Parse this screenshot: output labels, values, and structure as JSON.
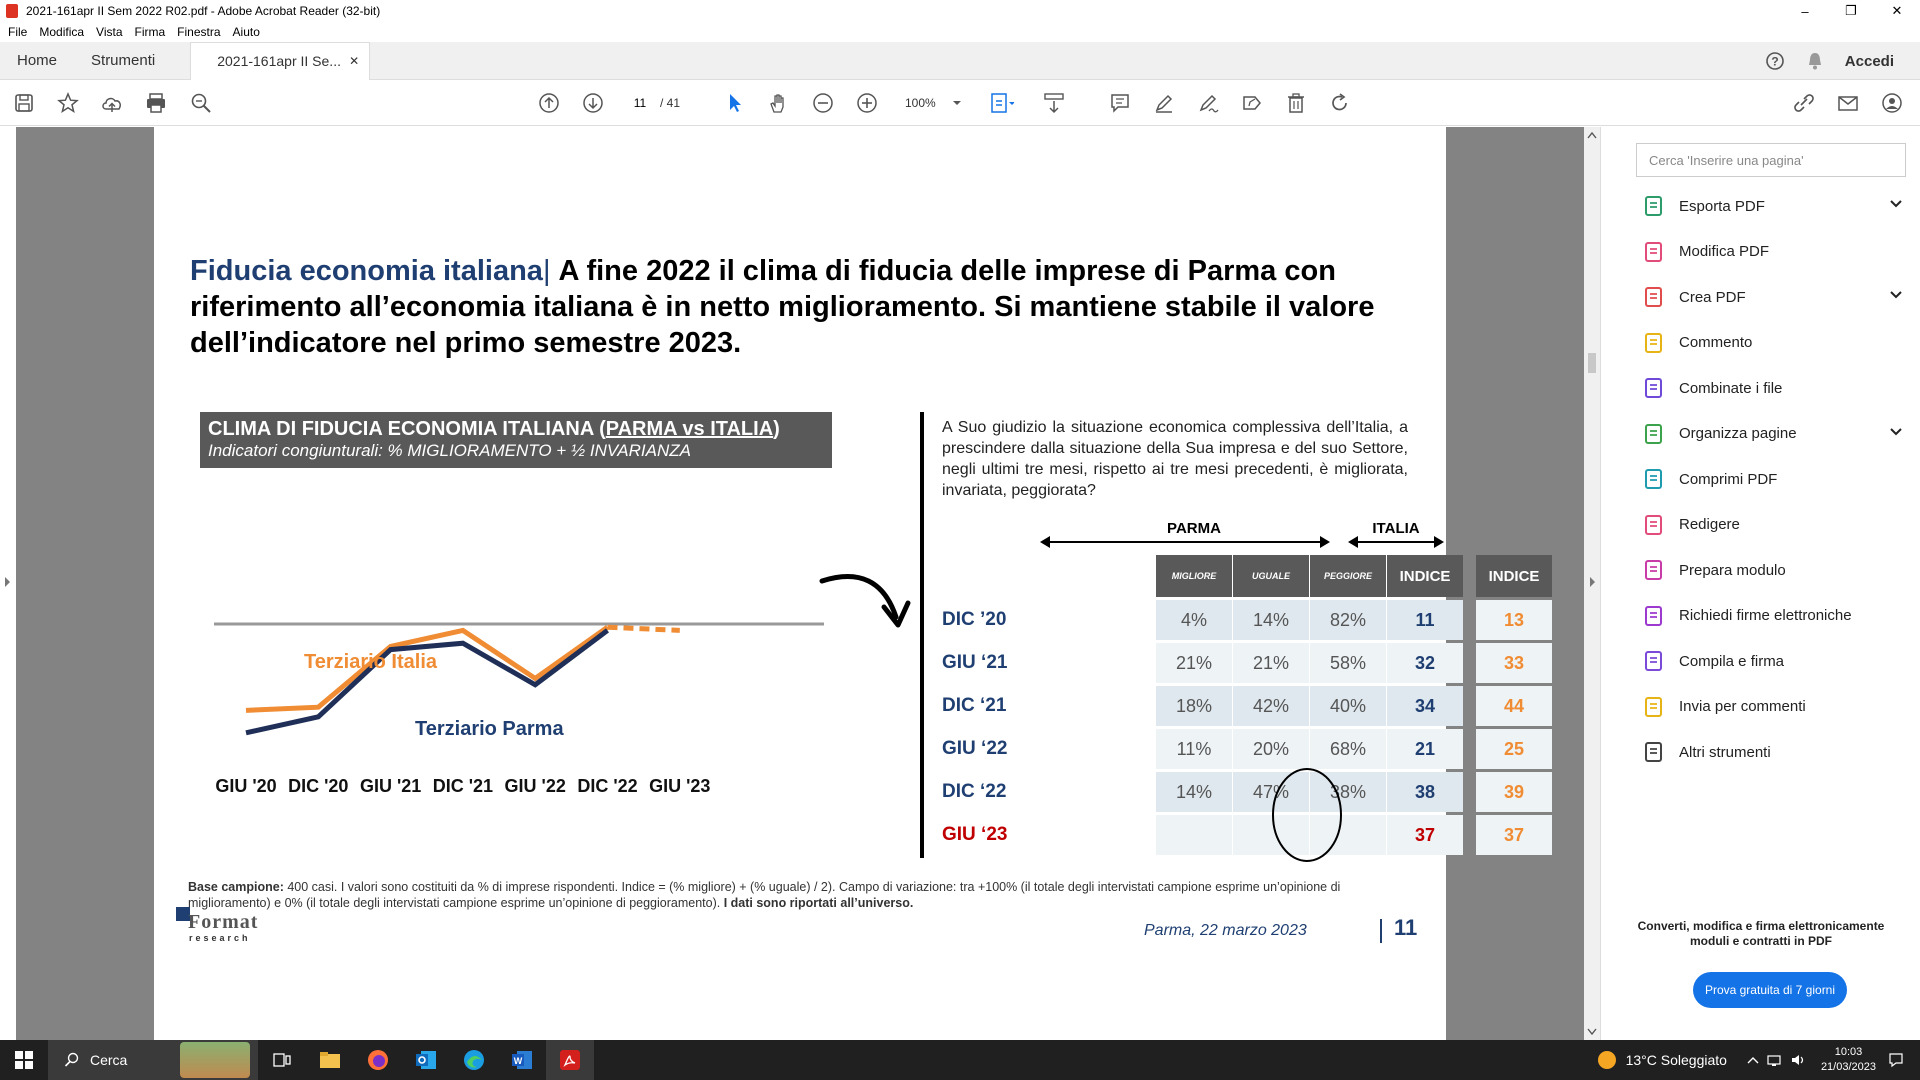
{
  "window": {
    "title": "2021-161apr II Sem 2022 R02.pdf - Adobe Acrobat Reader (32-bit)",
    "controls": [
      "–",
      "❐",
      "✕"
    ]
  },
  "menu": [
    "File",
    "Modifica",
    "Vista",
    "Firma",
    "Finestra",
    "Aiuto"
  ],
  "tabs": {
    "home": "Home",
    "tools": "Strumenti",
    "doc": "2021-161apr II Se...",
    "close": "✕",
    "signin": "Accedi"
  },
  "toolbar": {
    "page_current": "11",
    "page_total": "/ 41",
    "zoom": "100%"
  },
  "page": {
    "title_lead": "Fiducia economia italiana",
    "title_sep": "| ",
    "title_rest": "A fine 2022 il clima di fiducia delle imprese di Parma con riferimento all’economia italiana è in netto miglioramento. Si mantiene stabile il valore dell’indicatore nel primo semestre 2023.",
    "box_line1_a": "CLIMA DI FIDUCIA ECONOMIA ITALIANA (",
    "box_line1_b": "PARMA vs ITALIA",
    "box_line1_c": ")",
    "box_line2": "Indicatori congiunturali: % MIGLIORAMENTO + ½ INVARIANZA",
    "question": "A Suo giudizio la situazione economica complessiva dell’Italia, a prescindere dalla situazione della Sua impresa e del suo Settore, negli ultimi tre mesi, rispetto ai tre mesi precedenti, è migliorata, invariata, peggiorata?",
    "parma_label": "PARMA",
    "italia_label": "ITALIA",
    "headers": [
      "MIGLIORE",
      "UGUALE",
      "PEGGIORE",
      "INDICE",
      "INDICE"
    ],
    "rows": [
      {
        "label": "DIC ’20",
        "m": "4%",
        "u": "14%",
        "p": "82%",
        "idx": "11",
        "ita": "13"
      },
      {
        "label": "GIU ‘21",
        "m": "21%",
        "u": "21%",
        "p": "58%",
        "idx": "32",
        "ita": "33"
      },
      {
        "label": "DIC ‘21",
        "m": "18%",
        "u": "42%",
        "p": "40%",
        "idx": "34",
        "ita": "44"
      },
      {
        "label": "GIU ‘22",
        "m": "11%",
        "u": "20%",
        "p": "68%",
        "idx": "21",
        "ita": "25"
      },
      {
        "label": "DIC ‘22",
        "m": "14%",
        "u": "47%",
        "p": "38%",
        "idx": "38",
        "ita": "39"
      },
      {
        "label": "GIU ‘23",
        "m": "",
        "u": "",
        "p": "",
        "idx": "37",
        "ita": "37"
      }
    ],
    "footnote_bold": "Base campione:",
    "footnote_text": " 400 casi. I valori sono costituiti da % di imprese rispondenti. Indice = (% migliore) + (% uguale) / 2). Campo di variazione: tra +100% (il totale degli intervistati campione esprime un’opinione di miglioramento) e 0% (il totale degli intervistati campione esprime un’opinione di peggioramento). ",
    "footnote_bold2": "I dati sono riportati all’universo.",
    "logo_word": "Format",
    "logo_sub": "research",
    "footer": "Parma,  22 marzo 2023",
    "page_number": "11"
  },
  "chart_data": {
    "type": "line",
    "x": [
      "GIU '20",
      "DIC '20",
      "GIU '21",
      "DIC '21",
      "GIU '22",
      "DIC '22",
      "GIU '23"
    ],
    "series": [
      {
        "name": "Terziario Italia",
        "color": "#f08c33",
        "values": [
          13,
          14,
          33,
          38,
          23,
          39,
          38
        ],
        "projected_from": 5
      },
      {
        "name": "Terziario Parma",
        "color": "#1f2f58",
        "values": [
          6,
          11,
          32,
          34,
          21,
          38,
          null
        ]
      }
    ]
  },
  "right_panel": {
    "search_placeholder": "Cerca 'Inserire una pagina'",
    "items": [
      {
        "label": "Esporta PDF",
        "color": "#2d9b6a",
        "chevron": true
      },
      {
        "label": "Modifica PDF",
        "color": "#e14c7a",
        "chevron": false
      },
      {
        "label": "Crea PDF",
        "color": "#e14c4c",
        "chevron": true
      },
      {
        "label": "Commento",
        "color": "#e7b416",
        "chevron": false
      },
      {
        "label": "Combinate i file",
        "color": "#6f4ad8",
        "chevron": false
      },
      {
        "label": "Organizza pagine",
        "color": "#3ca34c",
        "chevron": true
      },
      {
        "label": "Comprimi PDF",
        "color": "#1f9bb0",
        "chevron": false
      },
      {
        "label": "Redigere",
        "color": "#e14c7a",
        "chevron": false
      },
      {
        "label": "Prepara modulo",
        "color": "#c83ca8",
        "chevron": false
      },
      {
        "label": "Richiedi firme elettroniche",
        "color": "#9c3ad0",
        "chevron": false
      },
      {
        "label": "Compila e firma",
        "color": "#7a4ad8",
        "chevron": false
      },
      {
        "label": "Invia per commenti",
        "color": "#e7b416",
        "chevron": false
      },
      {
        "label": "Altri strumenti",
        "color": "#444444",
        "chevron": false
      }
    ],
    "promo": "Converti, modifica e firma elettronicamente moduli e contratti in PDF",
    "button": "Prova gratuita di 7 giorni"
  },
  "taskbar": {
    "search": "Cerca",
    "weather": "13°C  Soleggiato",
    "time": "10:03",
    "date": "21/03/2023"
  }
}
